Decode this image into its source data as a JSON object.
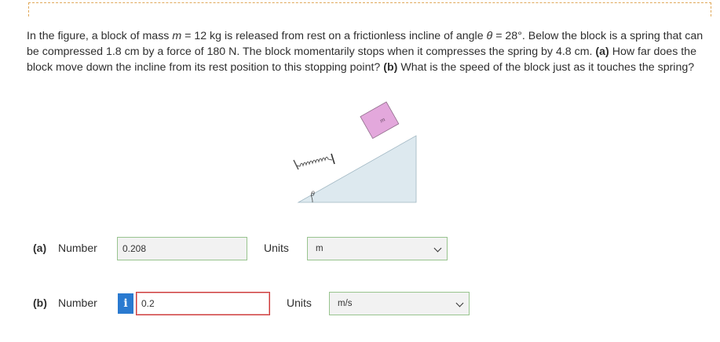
{
  "problem": {
    "line1_a": "In the figure, a block of mass ",
    "m_var": "m",
    "line1_b": " = 12 kg is released from rest on a frictionless incline of angle ",
    "theta_var": "θ",
    "line1_c": " = 28°. Below the block is a spring that can be compressed 1.8 cm by a force of 180 N. The block momentarily stops when it compresses the spring by 4.8 cm. ",
    "part_a_tag": "(a)",
    "part_a_text": " How far does the block move down the incline from its rest position to this stopping point? ",
    "part_b_tag": "(b)",
    "part_b_text": " What is the speed of the block just as it touches the spring?"
  },
  "figure": {
    "block_label": "m",
    "angle_label": "θ",
    "block_color": "#e3a8dc",
    "incline_color": "#dde9ef"
  },
  "part_a": {
    "tag": "(a)",
    "number_label": "Number",
    "value": "0.208",
    "units_label": "Units",
    "units_value": "m"
  },
  "part_b": {
    "tag": "(b)",
    "number_label": "Number",
    "info_icon": "i",
    "value": "0.2",
    "units_label": "Units",
    "units_value": "m/s"
  }
}
